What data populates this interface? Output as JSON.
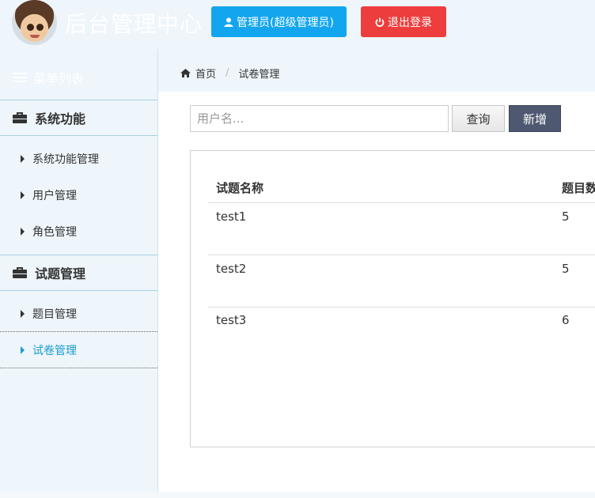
{
  "header": {
    "app_title": "后台管理中心",
    "admin_button": "管理员(超级管理员)",
    "logout_button": "退出登录"
  },
  "sidebar": {
    "menu_title": "菜单列表",
    "groups": [
      {
        "label": "系统功能",
        "items": [
          "系统功能管理",
          "用户管理",
          "角色管理"
        ]
      },
      {
        "label": "试题管理",
        "items": [
          "题目管理",
          "试卷管理"
        ]
      }
    ],
    "active_item": "试卷管理"
  },
  "breadcrumb": {
    "home": "首页",
    "current": "试卷管理"
  },
  "search": {
    "placeholder": "用户名...",
    "value": "",
    "query_button": "查询",
    "add_button": "新增"
  },
  "table": {
    "columns": [
      "试题名称",
      "题目数"
    ],
    "rows": [
      [
        "test1",
        "5"
      ],
      [
        "test2",
        "5"
      ],
      [
        "test3",
        "6"
      ]
    ]
  },
  "colors": {
    "admin_button": "#13a6ee",
    "logout_button": "#ee3d3d",
    "add_button": "#4e5870",
    "active_menu": "#1a9bd0",
    "background": "#eef6fb"
  }
}
